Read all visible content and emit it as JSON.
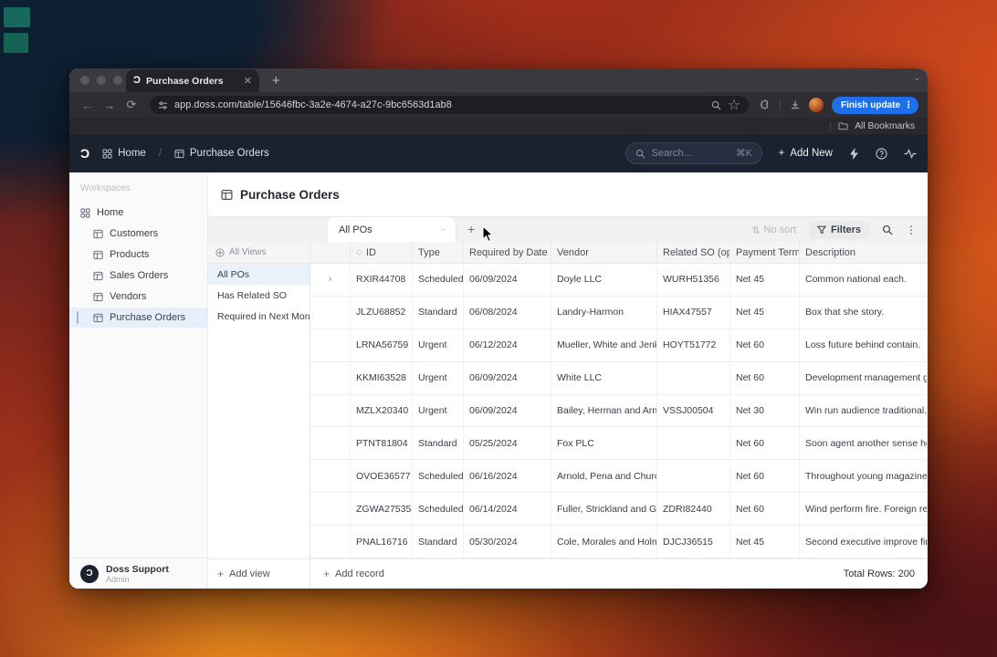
{
  "browser": {
    "tab_title": "Purchase Orders",
    "url": "app.doss.com/table/15646fbc-3a2e-4674-a27c-9bc6563d1ab8",
    "update_button": "Finish update",
    "bookmarks_label": "All Bookmarks"
  },
  "app": {
    "topnav": {
      "breadcrumb_home": "Home",
      "breadcrumb_sep": "/",
      "breadcrumb_page": "Purchase Orders",
      "search_placeholder": "Search...",
      "search_shortcut": "⌘K",
      "add_new": "Add New"
    },
    "sidebar": {
      "workspaces_label": "Workspaces",
      "home": "Home",
      "items": [
        "Customers",
        "Products",
        "Sales Orders",
        "Vendors",
        "Purchase Orders"
      ],
      "active_item": "Purchase Orders",
      "user": {
        "name": "Doss Support",
        "role": "Admin"
      }
    },
    "main": {
      "title": "Purchase Orders",
      "view_tab": "All POs",
      "toolbar": {
        "no_sort": "No sort",
        "filters": "Filters"
      },
      "views": {
        "header": "All Views",
        "items": [
          "All POs",
          "Has Related SO",
          "Required in Next Month"
        ],
        "active": "All POs",
        "add_view": "Add view"
      },
      "table": {
        "columns": [
          "ID",
          "Type",
          "Required by Date",
          "Vendor",
          "Related SO (opti",
          "Payment Terms",
          "Description"
        ],
        "rows": [
          {
            "expandable": true,
            "id": "RXIR44708",
            "type": "Scheduled",
            "required_by": "06/09/2024",
            "vendor": "Doyle LLC",
            "related_so": "WURH51356",
            "payment_terms": "Net 45",
            "description": "Common national each."
          },
          {
            "expandable": false,
            "id": "JLZU68852",
            "type": "Standard",
            "required_by": "06/08/2024",
            "vendor": "Landry-Harmon",
            "related_so": "HIAX47557",
            "payment_terms": "Net 45",
            "description": "Box that she story."
          },
          {
            "expandable": false,
            "id": "LRNA56759",
            "type": "Urgent",
            "required_by": "06/12/2024",
            "vendor": "Mueller, White and Jenkins",
            "related_so": "HOYT51772",
            "payment_terms": "Net 60",
            "description": "Loss future behind contain."
          },
          {
            "expandable": false,
            "id": "KKMI63528",
            "type": "Urgent",
            "required_by": "06/09/2024",
            "vendor": "White LLC",
            "related_so": "",
            "payment_terms": "Net 60",
            "description": "Development management grou"
          },
          {
            "expandable": false,
            "id": "MZLX20340",
            "type": "Urgent",
            "required_by": "06/09/2024",
            "vendor": "Bailey, Herman and Arnold",
            "related_so": "VSSJ00504",
            "payment_terms": "Net 30",
            "description": "Win run audience traditional. Pag"
          },
          {
            "expandable": false,
            "id": "PTNT81804",
            "type": "Standard",
            "required_by": "05/25/2024",
            "vendor": "Fox PLC",
            "related_so": "",
            "payment_terms": "Net 60",
            "description": "Soon agent another sense hot."
          },
          {
            "expandable": false,
            "id": "OVOE36577",
            "type": "Scheduled",
            "required_by": "06/16/2024",
            "vendor": "Arnold, Pena and Church",
            "related_so": "",
            "payment_terms": "Net 60",
            "description": "Throughout young magazine tea"
          },
          {
            "expandable": false,
            "id": "ZGWA27535",
            "type": "Scheduled",
            "required_by": "06/14/2024",
            "vendor": "Fuller, Strickland and Gray",
            "related_so": "ZDRI82440",
            "payment_terms": "Net 60",
            "description": "Wind perform fire. Foreign rest e"
          },
          {
            "expandable": false,
            "id": "PNAL16716",
            "type": "Standard",
            "required_by": "05/30/2024",
            "vendor": "Cole, Morales and Holmes",
            "related_so": "DJCJ36515",
            "payment_terms": "Net 45",
            "description": "Second executive improve finally"
          }
        ],
        "add_record": "Add record",
        "total_rows": "Total Rows: 200"
      }
    }
  },
  "colors": {
    "accent_blue": "#1f6feb",
    "navy_bar": "#1a222f",
    "selection": "#e7effb",
    "teal_widget": "#17695e"
  }
}
